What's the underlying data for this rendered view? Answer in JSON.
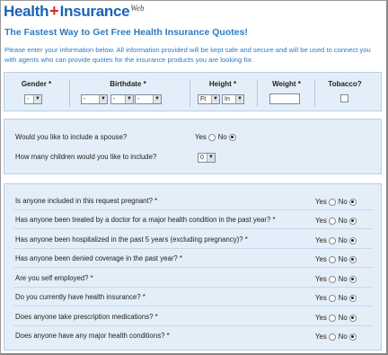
{
  "logo": {
    "text_health": "Health",
    "text_plus": "+",
    "text_insurance": "Insurance",
    "text_web": "Web"
  },
  "headline": "The Fastest Way to Get Free Health Insurance Quotes!",
  "intro": "Please enter your information below. All information provided will be kept safe and secure and will be used to connect you with agents who can provide quotes for the insurance products you are looking for.",
  "basic": {
    "gender": {
      "label": "Gender *",
      "value": "-"
    },
    "birthdate": {
      "label": "Birthdate *",
      "month": "-",
      "day": "-",
      "year": "-"
    },
    "height": {
      "label": "Height *",
      "feet": "Ft",
      "inches": "In"
    },
    "weight": {
      "label": "Weight *",
      "value": ""
    },
    "tobacco": {
      "label": "Tobacco?",
      "checked": false
    }
  },
  "family": {
    "spouse": {
      "question": "Would you like to include a spouse?",
      "yes": "Yes",
      "no": "No",
      "selected": "no"
    },
    "children": {
      "question": "How many children would you like to include?",
      "value": "0"
    }
  },
  "health_questions": [
    {
      "question": "Is anyone included in this request pregnant? *",
      "yes": "Yes",
      "no": "No",
      "selected": "no"
    },
    {
      "question": "Has anyone been treated by a doctor for a major health condition in the past year? *",
      "yes": "Yes",
      "no": "No",
      "selected": "no"
    },
    {
      "question": "Has anyone been hospitalized in the past 5 years (excluding pregnancy)? *",
      "yes": "Yes",
      "no": "No",
      "selected": "no"
    },
    {
      "question": "Has anyone been denied coverage in the past year? *",
      "yes": "Yes",
      "no": "No",
      "selected": "no"
    },
    {
      "question": "Are you self employed? *",
      "yes": "Yes",
      "no": "No",
      "selected": "no"
    },
    {
      "question": "Do you currently have health insurance? *",
      "yes": "Yes",
      "no": "No",
      "selected": "no"
    },
    {
      "question": "Does anyone take prescription medications? *",
      "yes": "Yes",
      "no": "No",
      "selected": "no"
    },
    {
      "question": "Does anyone have any major health conditions? *",
      "yes": "Yes",
      "no": "No",
      "selected": "no"
    }
  ],
  "colors": {
    "brand_blue": "#1b63b4",
    "brand_red": "#d7261f",
    "headline_blue": "#2c7bc3",
    "panel_bg": "#e3eef9"
  }
}
